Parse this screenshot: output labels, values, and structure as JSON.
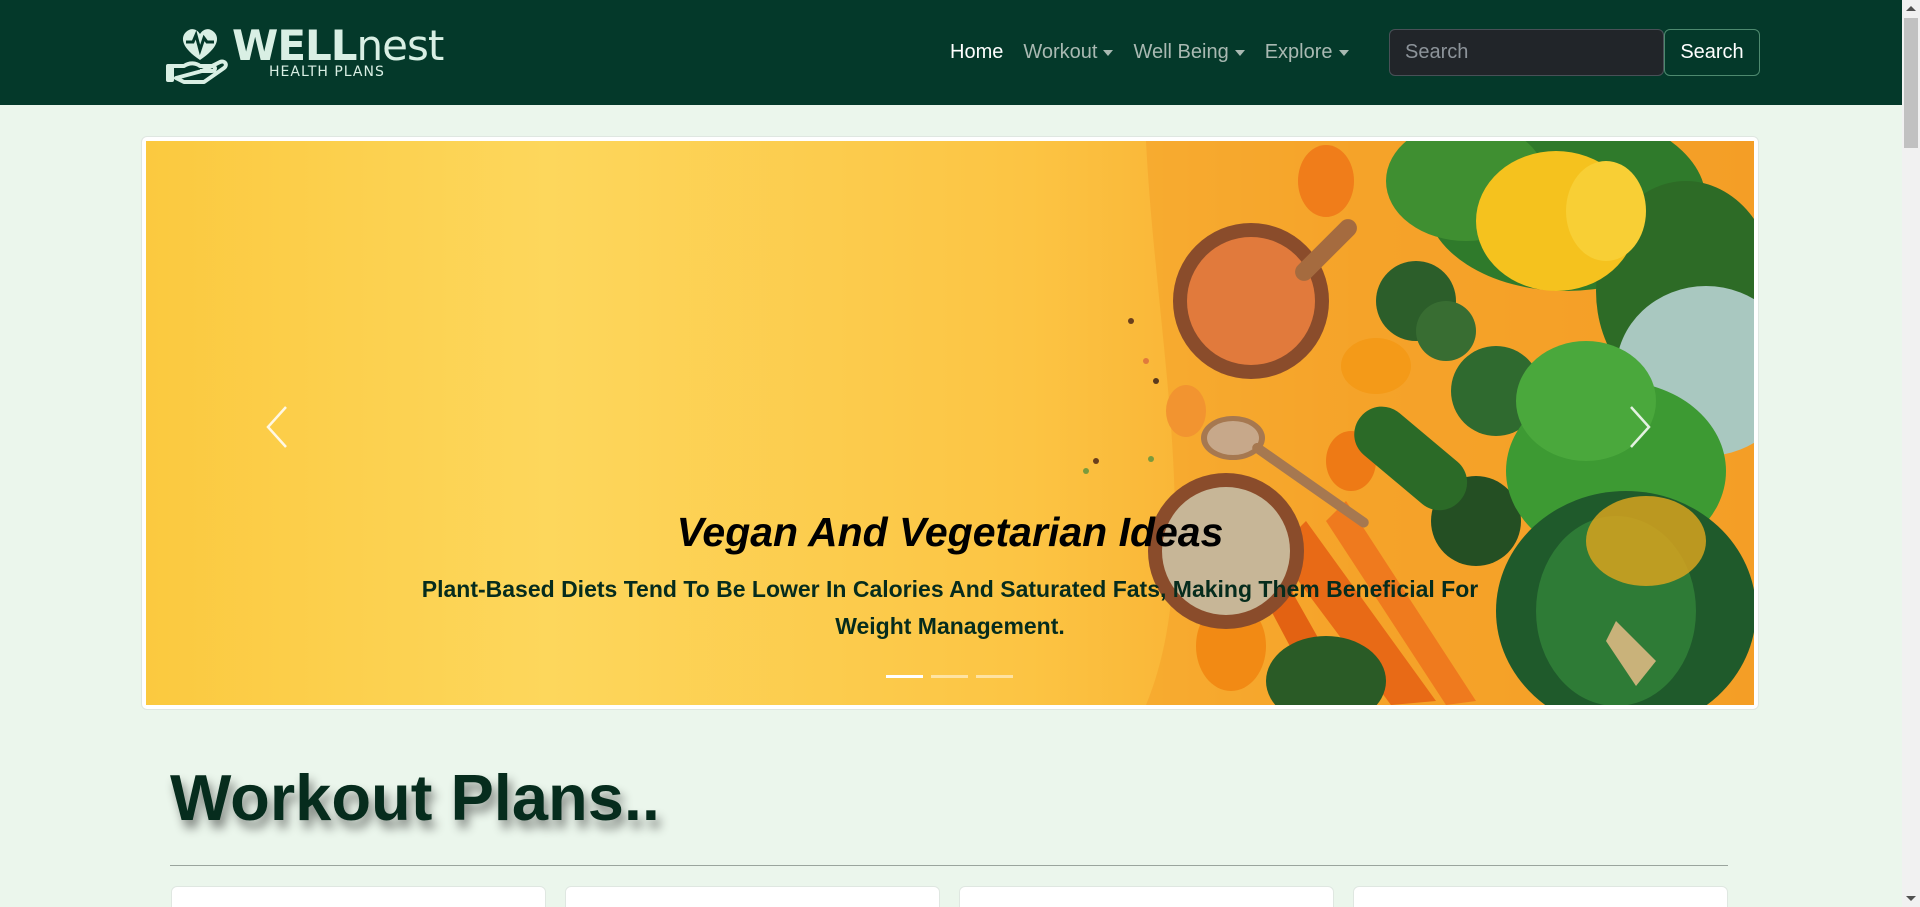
{
  "brand": {
    "name_bold": "WELL",
    "name_light": "nest",
    "tagline": "HEALTH PLANS"
  },
  "nav": {
    "items": [
      {
        "label": "Home",
        "active": true,
        "dropdown": false
      },
      {
        "label": "Workout",
        "active": false,
        "dropdown": true
      },
      {
        "label": "Well Being",
        "active": false,
        "dropdown": true
      },
      {
        "label": "Explore",
        "active": false,
        "dropdown": true
      }
    ],
    "search_placeholder": "Search",
    "search_button": "Search"
  },
  "carousel": {
    "title": "Vegan And Vegetarian Ideas",
    "text": "Plant-Based Diets Tend To Be Lower In Calories And Saturated Fats, Making Them Beneficial For Weight Management.",
    "slides": 3,
    "active_slide": 1
  },
  "section": {
    "title": "Workout Plans.."
  },
  "colors": {
    "nav_bg": "#04392a",
    "page_bg": "#ebf6ec",
    "heading": "#062c1d"
  },
  "icons": [
    "heart-hand-logo-icon",
    "chevron-left-icon",
    "chevron-right-icon",
    "caret-down-icon"
  ]
}
